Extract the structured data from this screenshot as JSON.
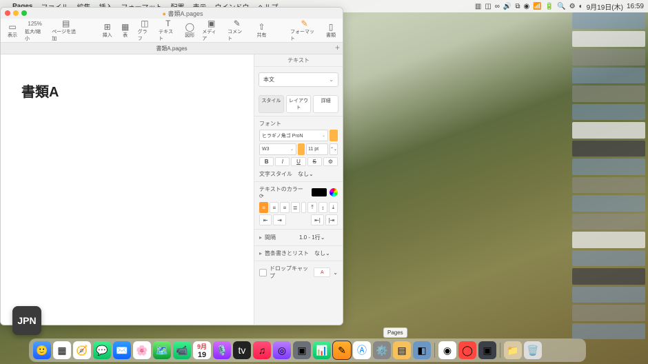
{
  "menubar": {
    "app": "Pages",
    "items": [
      "ファイル",
      "編集",
      "挿入",
      "フォーマット",
      "配置",
      "表示",
      "ウインドウ",
      "ヘルプ"
    ],
    "date": "9月19日(木)",
    "time": "16:59"
  },
  "window": {
    "title": "書類A.pages",
    "tab": "書類A.pages",
    "zoom": "125%",
    "toolbar": {
      "view": "表示",
      "zoom": "拡大/縮小",
      "addpage": "ページを追加",
      "insert": "挿入",
      "table": "表",
      "chart": "グラフ",
      "text": "テキスト",
      "shape": "図形",
      "media": "メディア",
      "comment": "コメント",
      "collab": "共有",
      "format": "フォーマット",
      "document": "書類"
    },
    "doc_heading": "書類A"
  },
  "inspector": {
    "header": "テキスト",
    "paragraph_style": "本文",
    "tabs": {
      "style": "スタイル",
      "layout": "レイアウト",
      "more": "詳細"
    },
    "font_label": "フォント",
    "font_family": "ヒラギノ角ゴ ProN",
    "font_weight": "W3",
    "font_size": "11 pt",
    "char_style_label": "文字スタイル",
    "char_style_value": "なし",
    "color_label": "テキストのカラー",
    "spacing_label": "間隔",
    "spacing_value": "1.0 - 1行",
    "bullets_label": "箇条書きとリスト",
    "bullets_value": "なし",
    "dropcap_label": "ドロップキャップ",
    "dropcap_glyph": "A"
  },
  "jpn_badge": "JPN",
  "dock_tooltip": "Pages"
}
